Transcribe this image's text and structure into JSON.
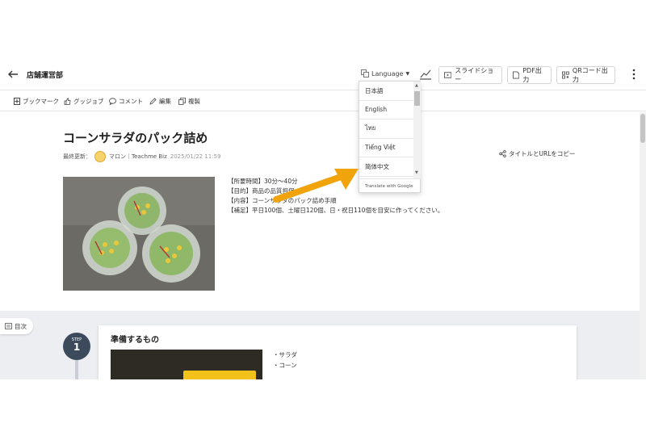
{
  "header": {
    "title": "店舗運営部",
    "language_label": "Language",
    "slideshow_label": "スライドショー",
    "pdf_label": "PDF出力",
    "qr_label": "QRコード出力"
  },
  "actions": {
    "bookmark": "ブックマーク",
    "goodjob": "グッジョブ",
    "comment": "コメント",
    "edit": "編集",
    "copy": "複製"
  },
  "doc": {
    "title": "コーンサラダのパック詰め",
    "updated_label": "最終更新：",
    "author": "マロン｜Teachme Biz",
    "date": "2025/01/22 11:59",
    "copy_link_label": "タイトルとURLをコピー",
    "info_lines": [
      "【所要時間】30分～40分",
      "【目的】商品の品質担保",
      "【内容】コーンサラダのパック詰め手順",
      "【補足】平日100個、土曜日120個、日・祝日110個を目安に作ってください。"
    ]
  },
  "toc_label": "目次",
  "step": {
    "label": "STEP",
    "number": "1",
    "title": "準備するもの",
    "items": [
      "・サラダ",
      "・コーン"
    ]
  },
  "language_menu": {
    "options": [
      "日本語",
      "English",
      "ไทย",
      "Tiếng Việt",
      "简体中文"
    ],
    "footer": "Translate with Google"
  },
  "colors": {
    "arrow": "#f0a30a",
    "step_circle": "#3c4a5c",
    "avatar": "#f6d36b"
  }
}
